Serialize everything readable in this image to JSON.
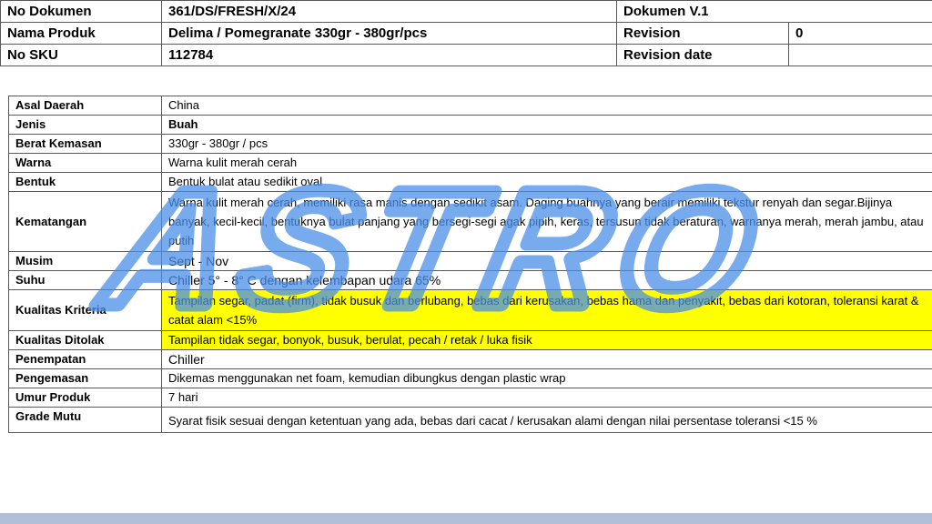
{
  "header": {
    "no_dokumen_label": "No Dokumen",
    "no_dokumen_value": "361/DS/FRESH/X/24",
    "dokumen_version": "Dokumen V.1",
    "nama_produk_label": "Nama Produk",
    "nama_produk_value": "Delima / Pomegranate 330gr - 380gr/pcs",
    "revision_label": "Revision",
    "revision_value": "0",
    "no_sku_label": "No SKU",
    "no_sku_value": "112784",
    "revision_date_label": "Revision date",
    "revision_date_value": ""
  },
  "spec": {
    "asal_daerah": {
      "label": "Asal Daerah",
      "value": "China"
    },
    "jenis": {
      "label": "Jenis",
      "value": "Buah"
    },
    "berat_kemasan": {
      "label": "Berat Kemasan",
      "value": "330gr - 380gr / pcs"
    },
    "warna": {
      "label": "Warna",
      "value": "Warna kulit merah cerah"
    },
    "bentuk": {
      "label": "Bentuk",
      "value": "Bentuk bulat atau sedikit oval"
    },
    "kematangan": {
      "label": "Kematangan",
      "value": "Warna kulit merah cerah, memiliki rasa manis dengan sedikit asam. Daging buahnya yang berair memiliki tekstur renyah dan segar.Bijinya banyak, kecil-kecil, bentuknya bulat panjang yang bersegi-segi agak pipih, keras, tersusun tidak beraturan, warnanya merah, merah jambu, atau putih"
    },
    "musim": {
      "label": "Musim",
      "value": "Sept -  Nov"
    },
    "suhu": {
      "label": "Suhu",
      "value": "Chiller 5° - 8° C dengan kelembapan udara 65%"
    },
    "kualitas_kriteria": {
      "label": "Kualitas Kriteria",
      "value": "Tampilan segar, padat (firm), tidak busuk dan berlubang, bebas dari kerusakan, bebas hama dan penyakit, bebas dari kotoran, toleransi karat & catat alam <15%"
    },
    "kualitas_ditolak": {
      "label": "Kualitas Ditolak",
      "value": "Tampilan tidak segar, bonyok, busuk, berulat, pecah / retak / luka fisik"
    },
    "penempatan": {
      "label": "Penempatan",
      "value": "Chiller"
    },
    "pengemasan": {
      "label": "Pengemasan",
      "value": "Dikemas menggunakan net foam, kemudian dibungkus dengan plastic wrap"
    },
    "umur_produk": {
      "label": "Umur Produk",
      "value": "7 hari"
    },
    "grade_mutu": {
      "label": "Grade Mutu",
      "value": "Syarat fisik sesuai dengan ketentuan yang ada, bebas dari cacat / kerusakan alami dengan  nilai persentase toleransi <15 %"
    }
  },
  "watermark": {
    "text": "ASTRO",
    "color": "#4a8fe8"
  },
  "colors": {
    "highlight": "#ffff00",
    "footer_bar": "#b3bfd6"
  }
}
